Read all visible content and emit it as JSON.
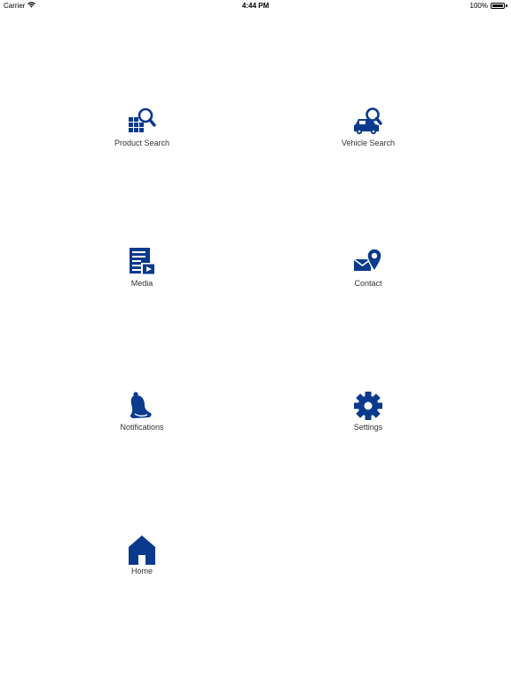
{
  "status_bar": {
    "carrier": "Carrier",
    "time": "4:44 PM",
    "battery": "100%",
    "battery_level": 1.0
  },
  "accent_color": "#0a3a8c",
  "menu": [
    {
      "label": "Product Search",
      "icon": "product-search-icon"
    },
    {
      "label": "Vehicle Search",
      "icon": "vehicle-search-icon"
    },
    {
      "label": "Media",
      "icon": "media-icon"
    },
    {
      "label": "Contact",
      "icon": "contact-icon"
    },
    {
      "label": "Notifications",
      "icon": "notifications-icon"
    },
    {
      "label": "Settings",
      "icon": "settings-icon"
    },
    {
      "label": "Home",
      "icon": "home-icon"
    }
  ]
}
